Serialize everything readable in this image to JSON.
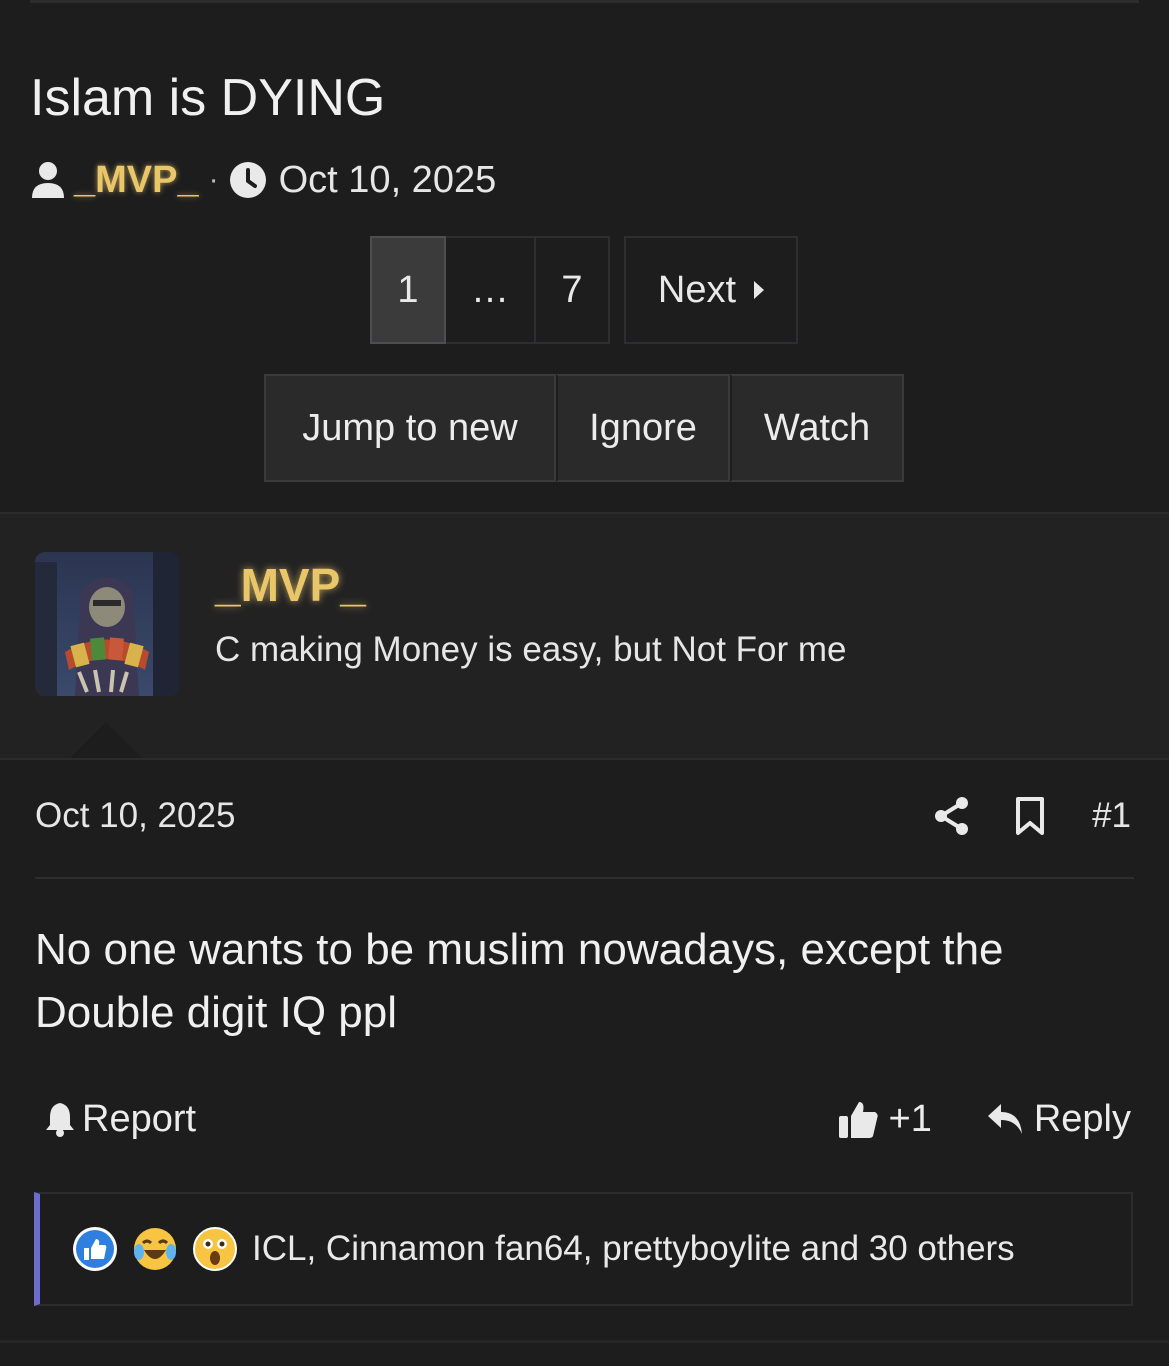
{
  "thread": {
    "title": "Islam is DYING",
    "author": "_MVP_",
    "separator": "·",
    "date": "Oct 10, 2025"
  },
  "pagination": {
    "current": "1",
    "ellipsis": "…",
    "last": "7",
    "next_label": "Next"
  },
  "actions": {
    "jump": "Jump to new",
    "ignore": "Ignore",
    "watch": "Watch"
  },
  "post": {
    "username": "_MVP_",
    "user_title": "C making Money is easy, but Not For me",
    "date": "Oct 10, 2025",
    "number": "#1",
    "body": "No one wants to be muslim nowadays, except the Double digit IQ ppl",
    "report_label": "Report",
    "like_label": "+1",
    "reply_label": "Reply",
    "reactions_text": "ICL, Cinnamon fan64, prettyboylite and 30 others",
    "reaction_icons": [
      "like-icon",
      "laughing-crying-icon",
      "shocked-icon"
    ]
  },
  "colors": {
    "background": "#1d1d1e",
    "username": "#e9c66a",
    "reaction_bar": "#6b6bd0"
  }
}
